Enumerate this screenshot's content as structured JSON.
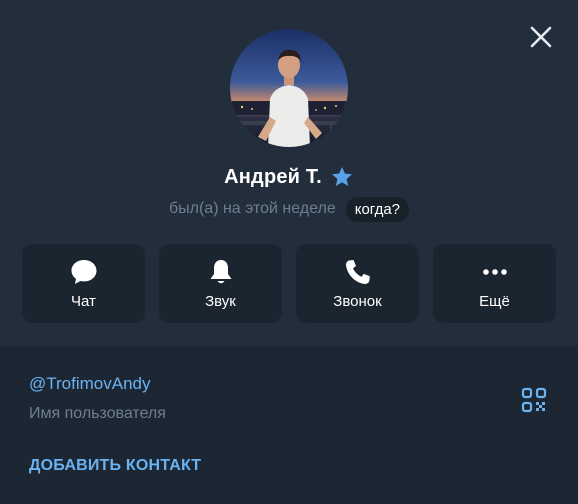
{
  "profile": {
    "name": "Андрей Т.",
    "status": "был(а) на этой неделе",
    "when_label": "когда?",
    "avatar_icon": "user-photo-avatar",
    "badge_icon": "star-icon",
    "badge_color": "#5aa2e8"
  },
  "actions": [
    {
      "label": "Чат",
      "icon": "chat-bubble-icon"
    },
    {
      "label": "Звук",
      "icon": "bell-icon"
    },
    {
      "label": "Звонок",
      "icon": "phone-icon"
    },
    {
      "label": "Ещё",
      "icon": "more-dots-icon"
    }
  ],
  "info": {
    "username": "@TrofimovAndy",
    "username_caption": "Имя пользователя",
    "qr_icon": "qr-code-icon",
    "add_contact_label": "ДОБАВИТЬ КОНТАКТ"
  },
  "colors": {
    "accent": "#6ab3f3",
    "background": "#1d2733",
    "header_panel": "#232e3c",
    "button_bg": "#1b2530",
    "muted_text": "#6d7f8f"
  }
}
